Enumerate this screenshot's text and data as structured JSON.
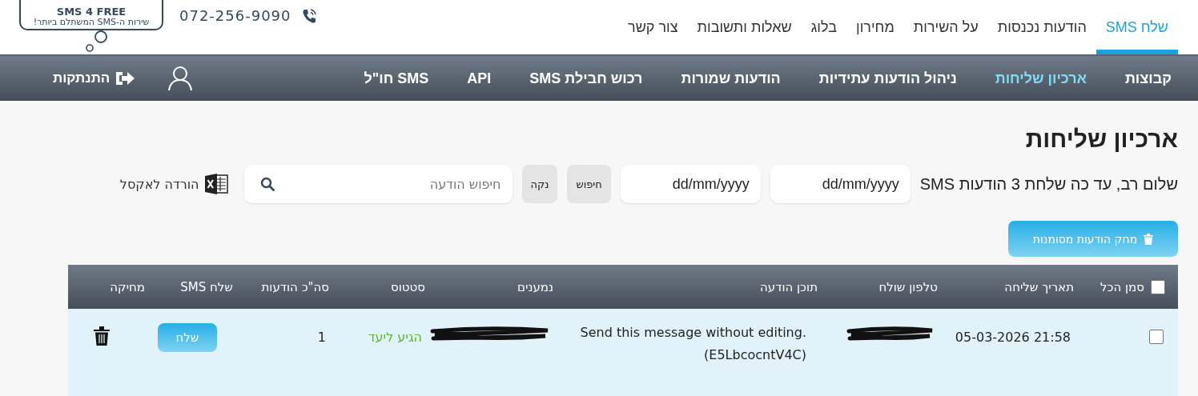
{
  "header": {
    "logo": {
      "title": "SMS 4 FREE",
      "tagline": "שירות ה-SMS המשתלם ביותר!"
    },
    "phone": "072-256-9090",
    "main_nav": [
      {
        "label": "שלח SMS",
        "selected": true
      },
      {
        "label": "הודעות נכנסות",
        "selected": false
      },
      {
        "label": "על השירות",
        "selected": false
      },
      {
        "label": "מחירון",
        "selected": false
      },
      {
        "label": "בלוג",
        "selected": false
      },
      {
        "label": "שאלות ותשובות",
        "selected": false
      },
      {
        "label": "צור קשר",
        "selected": false
      }
    ]
  },
  "sub_nav": {
    "items": [
      {
        "label": "קבוצות",
        "selected": false
      },
      {
        "label": "ארכיון שליחות",
        "selected": true
      },
      {
        "label": "ניהול הודעות עתידיות",
        "selected": false
      },
      {
        "label": "הודעות שמורות",
        "selected": false
      },
      {
        "label": "רכוש חבילת SMS",
        "selected": false
      },
      {
        "label": "API",
        "selected": false
      },
      {
        "label": "SMS חו\"ל",
        "selected": false
      }
    ],
    "logout": "התנתקות"
  },
  "page": {
    "title": "ארכיון שליחות",
    "greeting": "שלום רב, עד כה שלחת 3 הודעות SMS",
    "date_from": {
      "placeholder": "dd/mm/yyyy"
    },
    "date_to": {
      "placeholder": "dd/mm/yyyy"
    },
    "search_button": "חיפוש",
    "clear_button": "נקה",
    "search_field": {
      "placeholder": "חיפוש הודעה"
    },
    "export": "הורדה לאקסל",
    "delete_selected": "מחק הודעות מסומנות"
  },
  "table": {
    "select_all": {
      "label": "סמן הכל",
      "checked": false
    },
    "columns": [
      "תאריך שליחה",
      "טלפון שולח",
      "תוכן הודעה",
      "נמענים",
      "סטטוס",
      "סה\"כ הודעות",
      "שלח SMS",
      "מחיקה"
    ],
    "rows": [
      {
        "checked": false,
        "date": "05-03-2026 21:58",
        "sender": {
          "redacted": true
        },
        "content": "Send this message without editing. (E5LbcocntV4C)",
        "recipients": {
          "redacted": true
        },
        "status": {
          "label": "הגיע ליעד",
          "color": "#5cb82e"
        },
        "total": "1",
        "send_button": "שלח"
      }
    ]
  }
}
